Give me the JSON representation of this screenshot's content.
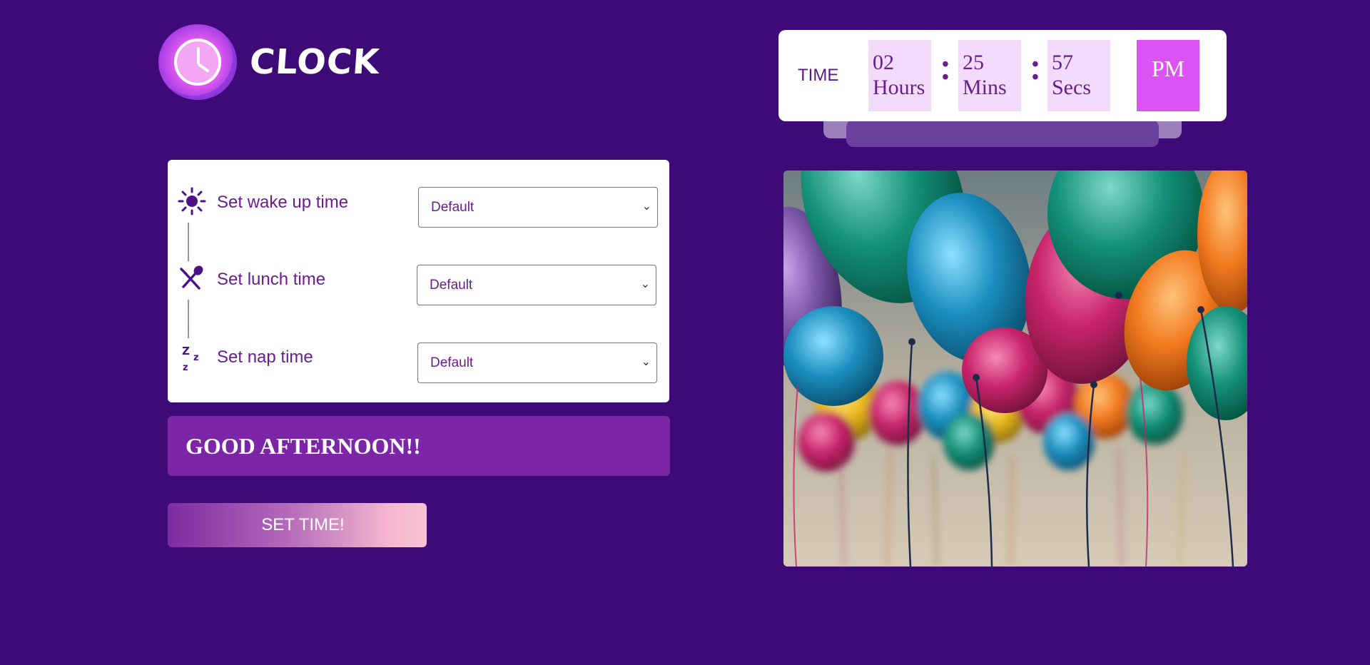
{
  "logo": {
    "text": "CLOCK",
    "icon": "clock-logo-icon"
  },
  "time": {
    "label": "TIME",
    "hours": "02",
    "hours_unit": "Hours",
    "mins": "25",
    "mins_unit": "Mins",
    "secs": "57",
    "secs_unit": "Secs",
    "colon": ":",
    "ampm": "PM"
  },
  "settings": {
    "wake": {
      "label": "Set wake up time",
      "selected": "Default",
      "icon": "sun-icon"
    },
    "lunch": {
      "label": "Set lunch time",
      "selected": "Default",
      "icon": "fork-spoon-icon"
    },
    "nap": {
      "label": "Set nap time",
      "selected": "Default",
      "icon": "zzz-icon"
    }
  },
  "greeting": "GOOD AFTERNOON!!",
  "set_time_button": "SET TIME!",
  "image": {
    "subject": "balloons-image"
  },
  "colors": {
    "background": "#3d0a78",
    "accent": "#dc52f2",
    "greeting_bg": "#7c25a6",
    "text_purple": "#6a1d8f"
  }
}
